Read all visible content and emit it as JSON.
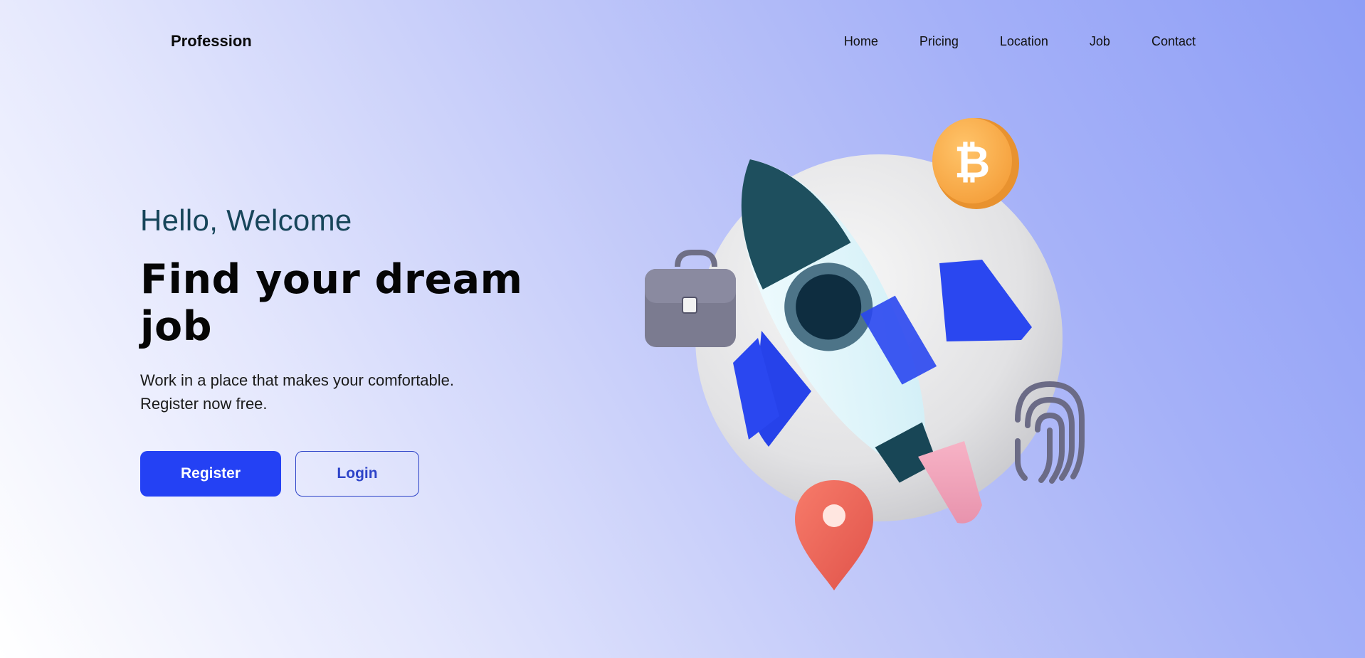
{
  "navbar": {
    "logo": "Profession",
    "links": [
      "Home",
      "Pricing",
      "Location",
      "Job",
      "Contact"
    ]
  },
  "hero": {
    "greeting": "Hello, Welcome",
    "headline": "Find your dream job",
    "description_line1": "Work in a place that makes your comfortable.",
    "description_line2": "Register now free.",
    "register_label": "Register",
    "login_label": "Login"
  },
  "colors": {
    "primary": "#2441f4",
    "greeting": "#17455a",
    "gradient_start": "#ffffff",
    "gradient_end": "#8e9ef6"
  },
  "illustration": {
    "icons": [
      "rocket-icon",
      "bitcoin-coin-icon",
      "briefcase-icon",
      "fingerprint-icon",
      "location-pin-icon"
    ]
  }
}
